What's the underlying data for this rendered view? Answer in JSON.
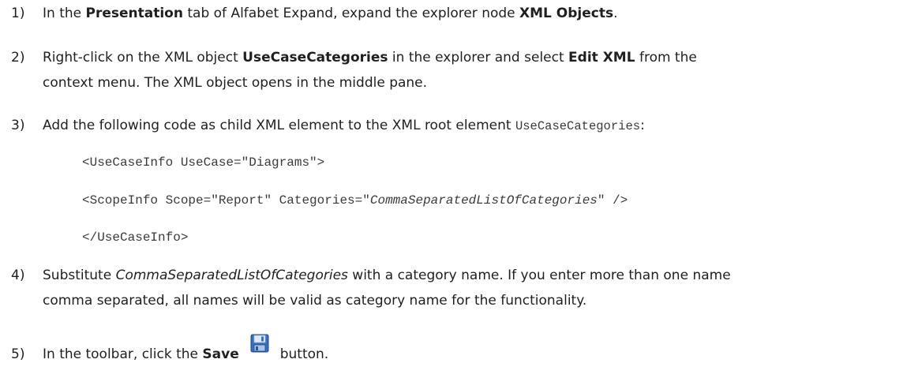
{
  "steps": [
    {
      "number": "1)",
      "parts": [
        "In the ",
        "Presentation",
        " tab of Alfabet Expand, expand the explorer node ",
        "XML Objects",
        "."
      ]
    },
    {
      "number": "2)",
      "parts": [
        "Right-click on the XML object ",
        "UseCaseCategories",
        " in the explorer and select ",
        "Edit XML",
        " from the"
      ],
      "continuation": "context menu. The XML object opens in the middle pane."
    },
    {
      "number": "3)",
      "parts": [
        "Add the following code as child XML element to the XML root element ",
        "UseCaseCategories",
        ":"
      ]
    },
    {
      "number": "4)",
      "parts": [
        "Substitute ",
        "CommaSeparatedListOfCategories",
        " with a category name. If you enter more than one name"
      ],
      "continuation": "comma separated, all names will be valid as category name for the functionality."
    },
    {
      "number": "5)",
      "parts": [
        "In the toolbar, click the ",
        "Save",
        "button."
      ]
    }
  ],
  "code": {
    "line1": "<UseCaseInfo UseCase=\"Diagrams\">",
    "line2_a": "<ScopeInfo Scope=\"Report\" Categories=\"",
    "line2_b": "CommaSeparatedListOfCategories",
    "line2_c": "\" />",
    "line3": "</UseCaseInfo>"
  },
  "icons": {
    "save": "save-floppy-icon"
  }
}
